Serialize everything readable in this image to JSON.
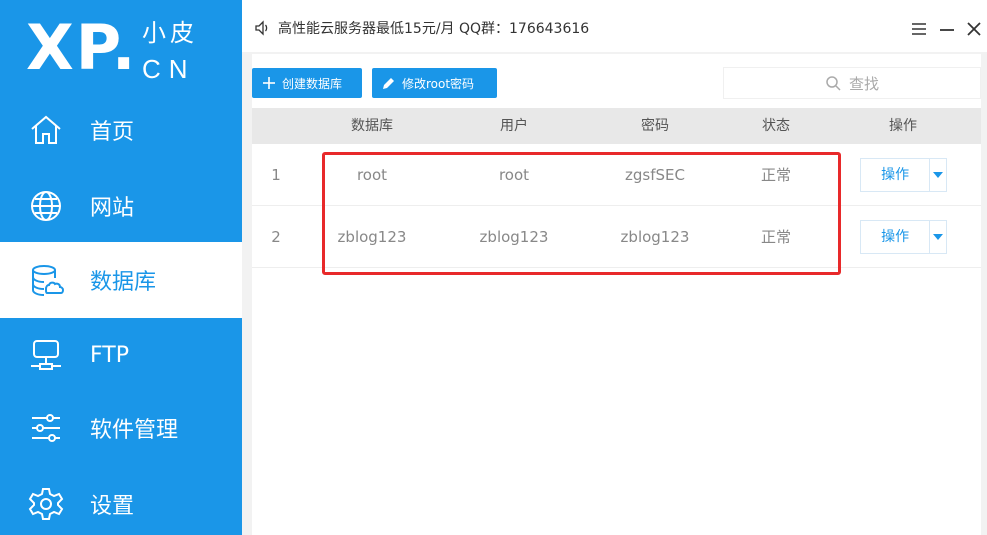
{
  "app": {
    "logo_main": "XP.",
    "logo_sub1": "小皮",
    "logo_sub2": "CN",
    "accent": "#1a96e8",
    "highlight_color": "#e8292a"
  },
  "sidebar": {
    "items": [
      {
        "label": "首页",
        "icon": "home-icon",
        "active": false
      },
      {
        "label": "网站",
        "icon": "globe-icon",
        "active": false
      },
      {
        "label": "数据库",
        "icon": "database-icon",
        "active": true
      },
      {
        "label": "FTP",
        "icon": "server-icon",
        "active": false
      },
      {
        "label": "软件管理",
        "icon": "sliders-icon",
        "active": false
      },
      {
        "label": "设置",
        "icon": "gear-icon",
        "active": false
      }
    ]
  },
  "topbar": {
    "notice": "高性能云服务器最低15元/月  QQ群：176643616"
  },
  "toolbar": {
    "create_db_label": "创建数据库",
    "change_root_label": "修改root密码",
    "search_placeholder": "查找"
  },
  "table": {
    "headers": [
      "数据库",
      "用户",
      "密码",
      "状态",
      "操作"
    ],
    "rows": [
      {
        "index": "1",
        "db": "root",
        "user": "root",
        "password": "zgsfSEC",
        "status": "正常",
        "action": "操作"
      },
      {
        "index": "2",
        "db": "zblog123",
        "user": "zblog123",
        "password": "zblog123",
        "status": "正常",
        "action": "操作"
      }
    ]
  }
}
